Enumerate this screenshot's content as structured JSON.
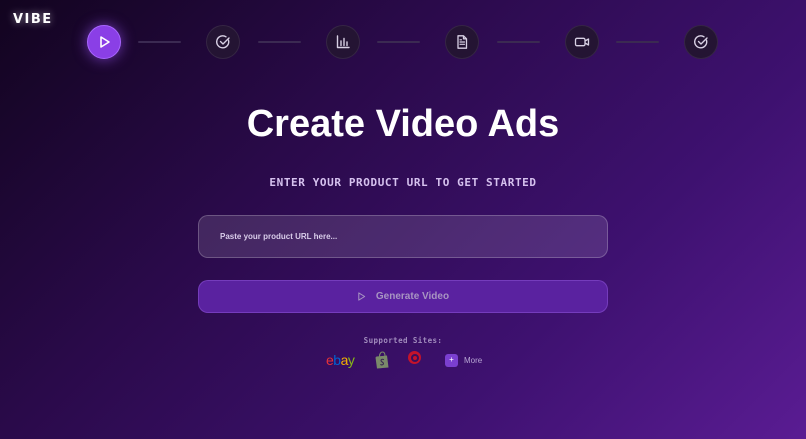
{
  "app": {
    "logo": "VIBE"
  },
  "steps": [
    {
      "icon": "play-icon",
      "active": true
    },
    {
      "icon": "check-circle-icon",
      "active": false
    },
    {
      "icon": "bar-chart-icon",
      "active": false
    },
    {
      "icon": "document-icon",
      "active": false
    },
    {
      "icon": "video-camera-icon",
      "active": false
    },
    {
      "icon": "check-circle-icon",
      "active": false
    }
  ],
  "hero": {
    "title": "Create Video Ads",
    "subtitle": "ENTER YOUR PRODUCT URL TO GET STARTED"
  },
  "form": {
    "url_value": "",
    "url_placeholder": "Paste your product URL here...",
    "generate_label": "Generate Video"
  },
  "supported": {
    "label": "Supported Sites:",
    "sites": [
      {
        "name": "ebay",
        "icon": "ebay-logo"
      },
      {
        "name": "shopify",
        "icon": "shopify-bag-icon"
      },
      {
        "name": "target",
        "icon": "target-bullseye-icon"
      }
    ],
    "more_icon": "plus-icon",
    "more_label": "More"
  },
  "colors": {
    "accent": "#8a3fe6",
    "button": "#5a22a0",
    "ebay_e": "#e53238",
    "ebay_b": "#0064d2",
    "ebay_a": "#f5af02",
    "ebay_y": "#86b817",
    "target_red": "#c4132b",
    "shopify_green": "#95bf47"
  }
}
